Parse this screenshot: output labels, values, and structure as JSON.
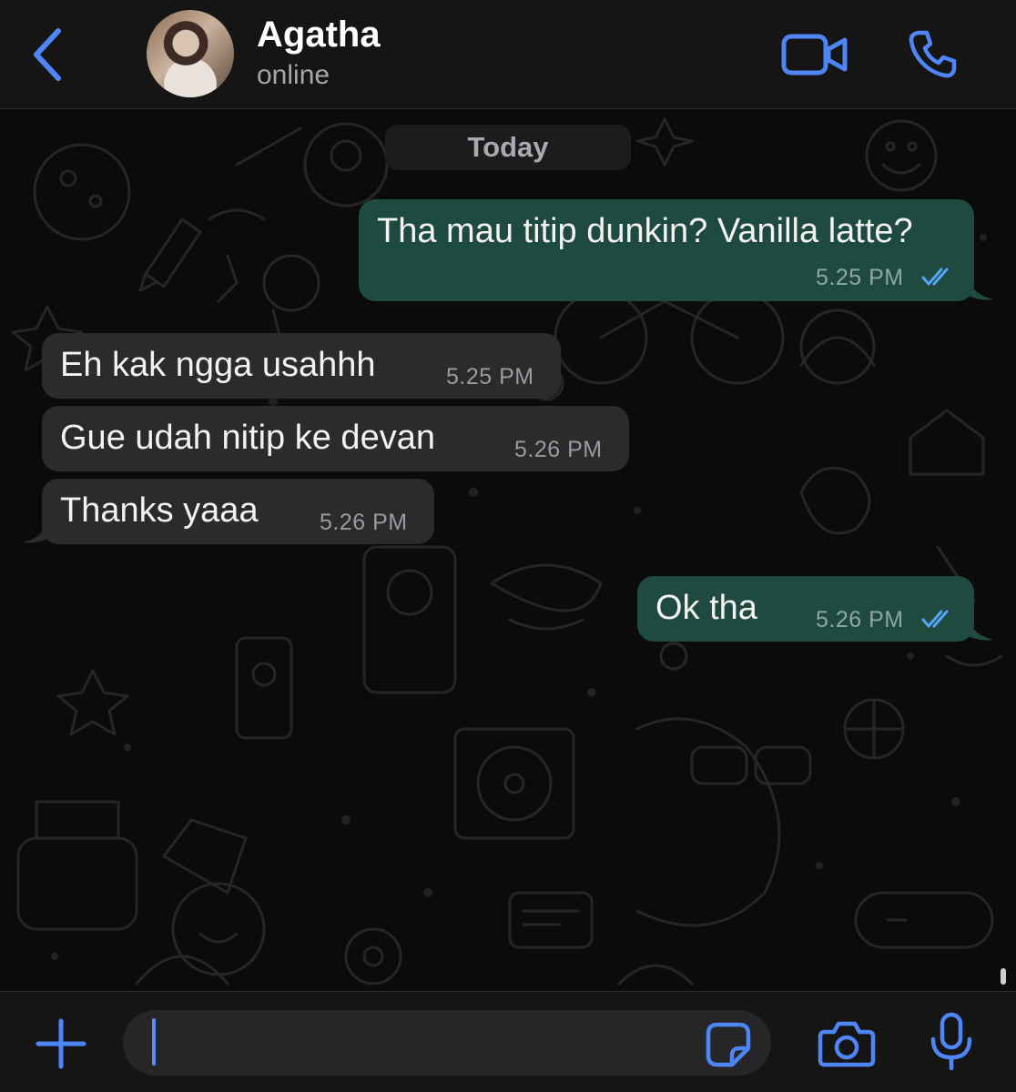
{
  "header": {
    "contact_name": "Agatha",
    "contact_status": "online"
  },
  "chat": {
    "date_divider": "Today",
    "messages": [
      {
        "direction": "outgoing",
        "text": "Tha mau titip dunkin? Vanilla latte?",
        "time": "5.25 PM",
        "read": true
      },
      {
        "direction": "incoming",
        "text": "Eh kak ngga usahhh",
        "time": "5.25 PM"
      },
      {
        "direction": "incoming",
        "text": "Gue udah nitip ke devan",
        "time": "5.26 PM"
      },
      {
        "direction": "incoming",
        "text": "Thanks yaaa",
        "time": "5.26 PM"
      },
      {
        "direction": "outgoing",
        "text": "Ok tha",
        "time": "5.26 PM",
        "read": true
      }
    ]
  },
  "composer": {
    "value": "",
    "placeholder": ""
  },
  "colors": {
    "accent": "#4f86f7",
    "outgoing_bubble": "#1e4a40",
    "incoming_bubble": "#2b2b2d",
    "read_ticks": "#53a6f5"
  },
  "icons": [
    "back-chevron-icon",
    "video-camera-icon",
    "phone-icon",
    "plus-icon",
    "sticker-icon",
    "camera-icon",
    "microphone-icon",
    "double-check-icon"
  ]
}
